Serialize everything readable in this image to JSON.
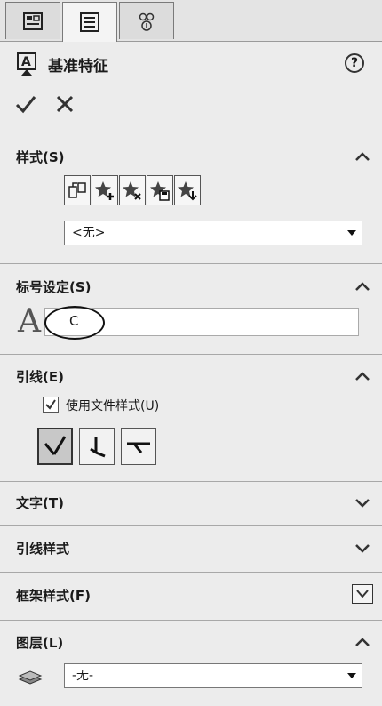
{
  "header": {
    "title": "基准特征"
  },
  "sections": {
    "style": {
      "title": "样式(S)",
      "select_value": "<无>"
    },
    "label": {
      "title": "标号设定(S)",
      "value": "C"
    },
    "leader": {
      "title": "引线(E)",
      "checkbox_label": "使用文件样式(U)",
      "checkbox_checked": true
    },
    "text": {
      "title": "文字(T)"
    },
    "leader_style": {
      "title": "引线样式"
    },
    "frame_style": {
      "title": "框架样式(F)"
    },
    "layer": {
      "title": "图层(L)",
      "select_value": "-无-"
    }
  }
}
